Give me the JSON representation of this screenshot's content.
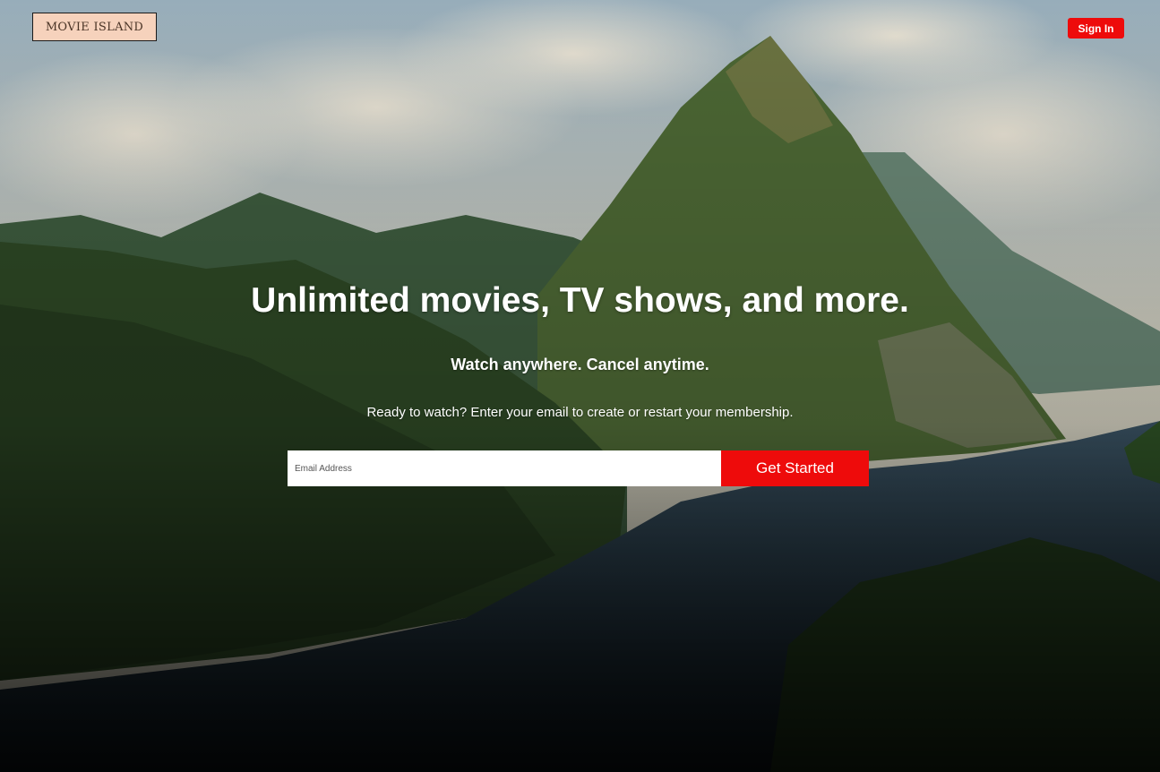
{
  "brand": {
    "logo_text": "MOVIE ISLAND",
    "logo_bg": "#f6d2bc"
  },
  "header": {
    "signin_label": "Sign In"
  },
  "hero": {
    "headline": "Unlimited movies, TV shows, and more.",
    "subhead": "Watch anywhere. Cancel anytime.",
    "prompt": "Ready to watch? Enter your email to create or restart your membership."
  },
  "signup": {
    "email_placeholder": "Email Address",
    "email_value": "",
    "button_label": "Get Started"
  },
  "colors": {
    "accent": "#ee0b0b",
    "text": "#ffffff"
  },
  "icons": {
    "background": "tropical-island-landscape-image"
  }
}
